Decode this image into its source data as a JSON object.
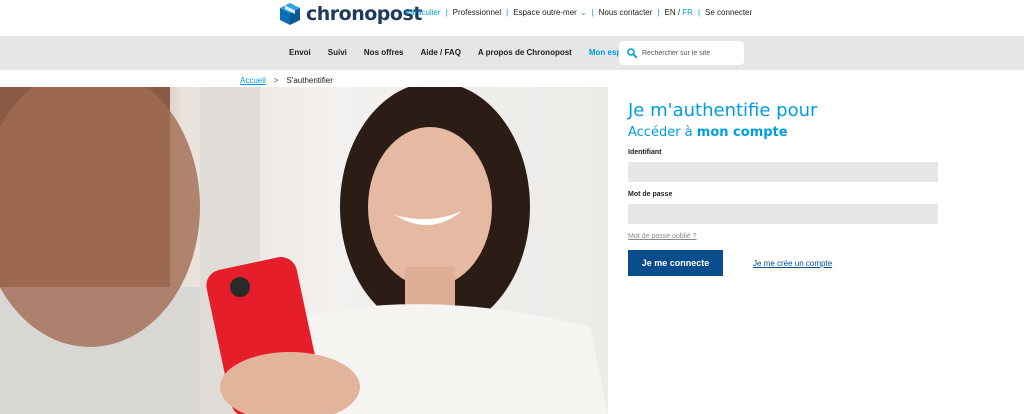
{
  "brand": {
    "name": "chronopost",
    "color": "#1f3a5f",
    "accent": "#009de0"
  },
  "top_links": [
    {
      "label": "Particulier",
      "active": true
    },
    {
      "label": "Professionnel"
    },
    {
      "label": "Espace outre-mer",
      "icon": "chevron-down-icon"
    },
    {
      "label": "Nous contacter"
    },
    {
      "label": "EN"
    },
    {
      "label": "FR",
      "active": true
    },
    {
      "label": "Se connecter"
    }
  ],
  "nav": [
    {
      "label": "Envoi"
    },
    {
      "label": "Suivi"
    },
    {
      "label": "Nos offres"
    },
    {
      "label": "Aide / FAQ"
    },
    {
      "label": "A propos de Chronopost"
    },
    {
      "label": "Mon espace",
      "active": true
    }
  ],
  "search": {
    "placeholder": "Rechercher sur le site",
    "icon": "search-icon"
  },
  "breadcrumb": {
    "home": "Accueil",
    "separator": ">",
    "current": "S'authentifier"
  },
  "login": {
    "title_line1": "Je m'authentifie pour",
    "title_line2_prefix": "Accéder à ",
    "title_line2_bold": "mon compte",
    "id_label": "Identifiant",
    "id_value": "",
    "pwd_label": "Mot de passe",
    "pwd_value": "",
    "forgot": "Mot de passe oublié ?",
    "submit": "Je me connecte",
    "create": "Je me crée un compte"
  }
}
